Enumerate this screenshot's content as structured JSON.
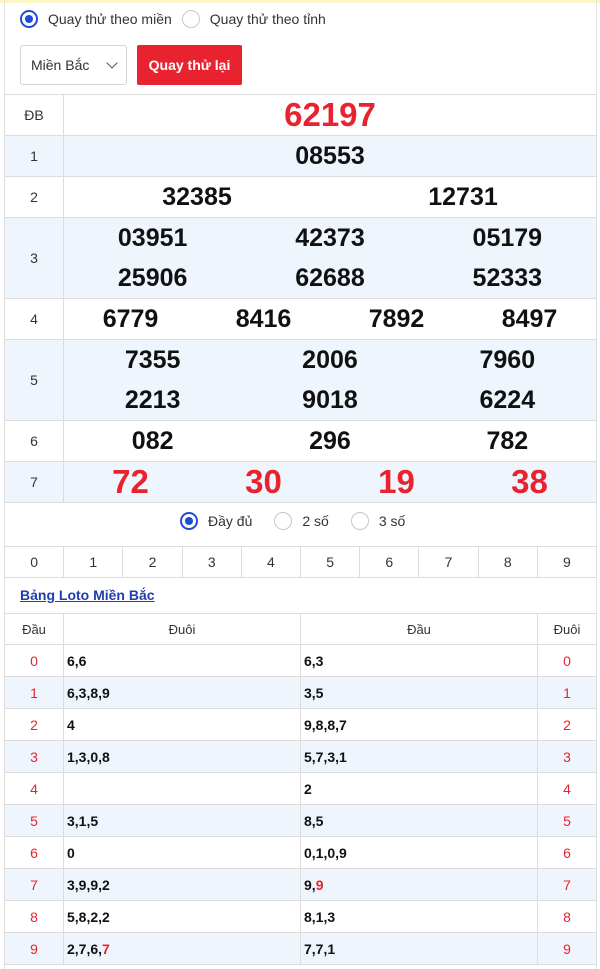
{
  "mode": {
    "options": [
      {
        "label": "Quay thử theo miền",
        "selected": true
      },
      {
        "label": "Quay thử theo tỉnh",
        "selected": false
      }
    ]
  },
  "controls": {
    "region": "Miền Bắc",
    "spin_button": "Quay thử lại"
  },
  "results": [
    {
      "label": "ĐB",
      "numbers": [
        "62197"
      ]
    },
    {
      "label": "1",
      "numbers": [
        "08553"
      ]
    },
    {
      "label": "2",
      "numbers": [
        "32385",
        "12731"
      ]
    },
    {
      "label": "3",
      "numbers": [
        "03951",
        "42373",
        "05179",
        "25906",
        "62688",
        "52333"
      ]
    },
    {
      "label": "4",
      "numbers": [
        "6779",
        "8416",
        "7892",
        "8497"
      ]
    },
    {
      "label": "5",
      "numbers": [
        "7355",
        "2006",
        "7960",
        "2213",
        "9018",
        "6224"
      ]
    },
    {
      "label": "6",
      "numbers": [
        "082",
        "296",
        "782"
      ]
    },
    {
      "label": "7",
      "numbers": [
        "72",
        "30",
        "19",
        "38"
      ]
    }
  ],
  "filter": {
    "options": [
      {
        "label": "Đầy đủ",
        "selected": true
      },
      {
        "label": "2 số",
        "selected": false
      },
      {
        "label": "3 số",
        "selected": false
      }
    ]
  },
  "digits": [
    "0",
    "1",
    "2",
    "3",
    "4",
    "5",
    "6",
    "7",
    "8",
    "9"
  ],
  "loto_link": "Bảng Loto Miền Bắc",
  "loto": {
    "headers": [
      "Đầu",
      "Đuôi",
      "Đầu",
      "Đuôi"
    ],
    "rows": [
      {
        "dau": "0",
        "duoi": "6,6",
        "dau_list": "6,3",
        "duoi_key": "0"
      },
      {
        "dau": "1",
        "duoi": "6,3,8,9",
        "dau_list": "3,5",
        "duoi_key": "1"
      },
      {
        "dau": "2",
        "duoi": "4",
        "dau_list": "9,8,8,7",
        "duoi_key": "2"
      },
      {
        "dau": "3",
        "duoi": "1,3,0,8",
        "dau_list": "5,7,3,1",
        "duoi_key": "3"
      },
      {
        "dau": "4",
        "duoi": "",
        "dau_list": "2",
        "duoi_key": "4"
      },
      {
        "dau": "5",
        "duoi": "3,1,5",
        "dau_list": "8,5",
        "duoi_key": "5"
      },
      {
        "dau": "6",
        "duoi": "0",
        "dau_list": "0,1,0,9",
        "duoi_key": "6"
      },
      {
        "dau": "7",
        "duoi": "3,9,9,2",
        "dau_list_prefix": "9,",
        "dau_list_special": "9",
        "duoi_key": "7"
      },
      {
        "dau": "8",
        "duoi": "5,8,2,2",
        "dau_list": "8,1,3",
        "duoi_key": "8"
      },
      {
        "dau": "9",
        "duoi_prefix": "2,7,6,",
        "duoi_special": "7",
        "dau_list": "7,7,1",
        "duoi_key": "9"
      }
    ]
  }
}
